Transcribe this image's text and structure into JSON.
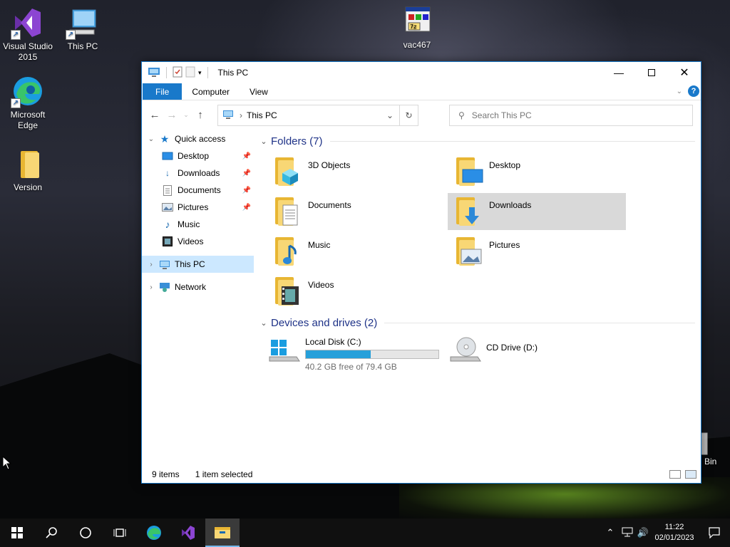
{
  "desktop": {
    "icons": [
      {
        "label": "Visual Studio\n2015"
      },
      {
        "label": "This PC"
      },
      {
        "label": "vac467"
      },
      {
        "label": "Microsoft\nEdge"
      },
      {
        "label": "Version"
      }
    ],
    "recycle_bin_partial": "Bin"
  },
  "window": {
    "title": "This PC",
    "ribbon_tabs": [
      "File",
      "Computer",
      "View"
    ],
    "address": {
      "location": "This PC"
    },
    "search": {
      "placeholder": "Search This PC"
    },
    "nav": {
      "quick_access": "Quick access",
      "quick_items": [
        "Desktop",
        "Downloads",
        "Documents",
        "Pictures",
        "Music",
        "Videos"
      ],
      "this_pc": "This PC",
      "network": "Network"
    },
    "folders_header": "Folders (7)",
    "folders": [
      "3D Objects",
      "Desktop",
      "Documents",
      "Downloads",
      "Music",
      "Pictures",
      "Videos"
    ],
    "selected_folder": "Downloads",
    "drives_header": "Devices and drives (2)",
    "drives": [
      {
        "name": "Local Disk (C:)",
        "free": "40.2 GB free of 79.4 GB",
        "used_fraction": 0.49
      },
      {
        "name": "CD Drive (D:)"
      }
    ],
    "status": {
      "items": "9 items",
      "selected": "1 item selected"
    }
  },
  "taskbar": {
    "time": "11:22",
    "date": "02/01/2023"
  },
  "colors": {
    "accent": "#1979ca",
    "selection": "#cce8ff",
    "drive_bar": "#26a0da"
  }
}
